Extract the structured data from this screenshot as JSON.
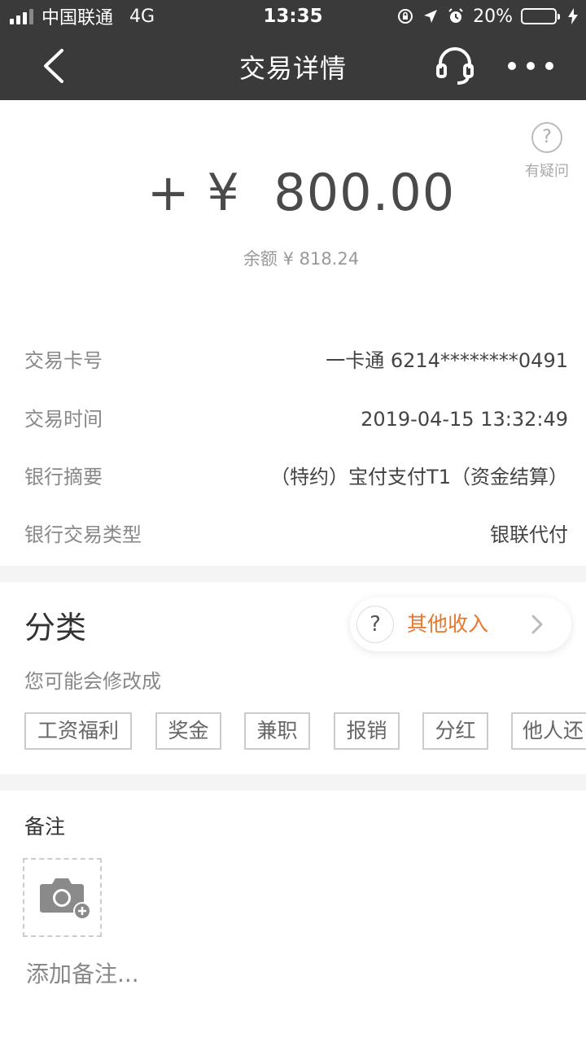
{
  "status_bar": {
    "carrier": "中国联通",
    "network": "4G",
    "time": "13:35",
    "battery_percent": "20%",
    "battery_level": 0.2,
    "icons": [
      "signal-icon",
      "rotation-lock-icon",
      "location-icon",
      "alarm-icon",
      "battery-icon",
      "charging-icon"
    ]
  },
  "navbar": {
    "title": "交易详情",
    "icons": [
      "back-arrow-icon",
      "headset-icon",
      "more-dots-icon"
    ]
  },
  "summary": {
    "help_label": "有疑问",
    "help_glyph": "?",
    "amount": "+ ¥  800.00",
    "balance": "余额 ¥ 818.24"
  },
  "details": [
    {
      "label": "交易卡号",
      "value": "一卡通 6214********0491"
    },
    {
      "label": "交易时间",
      "value": "2019-04-15 13:32:49"
    },
    {
      "label": "银行摘要",
      "value": "（特约）宝付支付T1（资金结算）"
    },
    {
      "label": "银行交易类型",
      "value": "银联代付"
    }
  ],
  "category": {
    "title": "分类",
    "current": "其他收入",
    "current_glyph": "?",
    "hint": "您可能会修改成",
    "suggestions": [
      "工资福利",
      "奖金",
      "兼职",
      "报销",
      "分红",
      "他人还"
    ]
  },
  "note": {
    "title": "备注",
    "placeholder": "添加备注...",
    "icons": [
      "camera-add-icon"
    ]
  },
  "colors": {
    "bar_background": "#3a3a3a",
    "accent_orange": "#e8772e",
    "battery_yellow": "#f5c518"
  }
}
